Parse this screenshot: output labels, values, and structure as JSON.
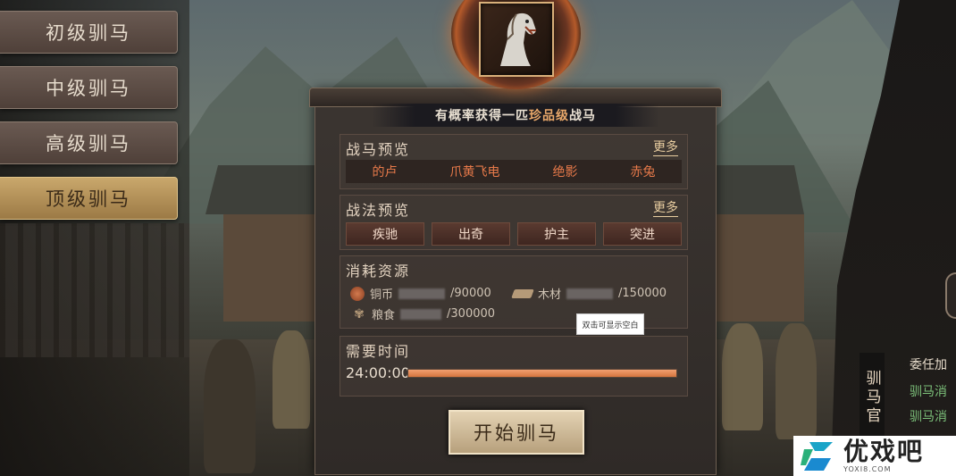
{
  "menu": {
    "items": [
      {
        "label": "初级驯马",
        "active": false
      },
      {
        "label": "中级驯马",
        "active": false
      },
      {
        "label": "高级驯马",
        "active": false
      },
      {
        "label": "顶级驯马",
        "active": true
      }
    ]
  },
  "banner": {
    "prefix": "有概率获得一匹",
    "rarity": "珍品级",
    "suffix": "战马"
  },
  "horse_preview": {
    "title": "战马预览",
    "more": "更多",
    "horses": [
      "的卢",
      "爪黄飞电",
      "绝影",
      "赤兔"
    ]
  },
  "tactic_preview": {
    "title": "战法预览",
    "more": "更多",
    "tactics": [
      "疾驰",
      "出奇",
      "护主",
      "突进"
    ]
  },
  "resources": {
    "title": "消耗资源",
    "copper": {
      "label": "铜币",
      "required": "/90000",
      "icon": "coin-icon"
    },
    "wood": {
      "label": "木材",
      "required": "/150000",
      "icon": "wood-icon"
    },
    "grain": {
      "label": "粮食",
      "required": "/300000",
      "icon": "grain-icon"
    },
    "tooltip": "双击可显示空白"
  },
  "time": {
    "title": "需要时间",
    "value": "24:00:00",
    "progress": 1.0
  },
  "start_button": "开始驯马",
  "officer": {
    "tab_label": "驯马官",
    "lines": [
      "委任加",
      "驯马消",
      "驯马消"
    ]
  },
  "watermark": {
    "name": "优戏吧",
    "url": "YOXI8.COM"
  },
  "colors": {
    "accent_gold": "#c9a86c",
    "horse_name": "#e87a4a",
    "progress": "#e88a55",
    "green_text": "#7cc07a"
  }
}
